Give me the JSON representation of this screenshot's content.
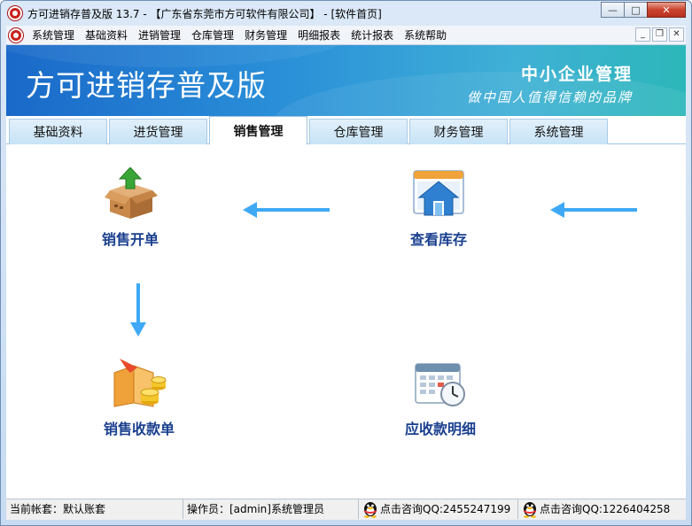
{
  "window": {
    "title": "方可进销存普及版 13.7 - 【广东省东莞市方可软件有限公司】 - [软件首页]",
    "minimize": "—",
    "maximize": "□",
    "close": "✕"
  },
  "menu": {
    "items": [
      "系统管理",
      "基础资料",
      "进销管理",
      "仓库管理",
      "财务管理",
      "明细报表",
      "统计报表",
      "系统帮助"
    ],
    "mdi_minimize": "_",
    "mdi_restore": "❐",
    "mdi_close": "✕"
  },
  "banner": {
    "title": "方可进销存普及版",
    "subtitle1": "中小企业管理",
    "subtitle2": "做中国人值得信赖的品牌"
  },
  "tabs": [
    {
      "label": "基础资料",
      "active": false
    },
    {
      "label": "进货管理",
      "active": false
    },
    {
      "label": "销售管理",
      "active": true
    },
    {
      "label": "仓库管理",
      "active": false
    },
    {
      "label": "财务管理",
      "active": false
    },
    {
      "label": "系统管理",
      "active": false
    }
  ],
  "functions": {
    "sales_order": {
      "label": "销售开单",
      "icon": "box-upload-icon"
    },
    "view_stock": {
      "label": "查看库存",
      "icon": "warehouse-icon"
    },
    "sales_receipt": {
      "label": "销售收款单",
      "icon": "coins-folder-icon"
    },
    "receivables": {
      "label": "应收款明细",
      "icon": "calendar-clock-icon"
    }
  },
  "status": {
    "account": "当前帐套：默认账套",
    "operator": "操作员：[admin]系统管理员",
    "qq1": "点击咨询QQ:2455247199",
    "qq2": "点击咨询QQ:1226404258"
  },
  "colors": {
    "arrow": "#3fa9f5",
    "function_label": "#1a3f8f",
    "banner_start": "#1a69c9",
    "banner_end": "#2cb7b9"
  }
}
